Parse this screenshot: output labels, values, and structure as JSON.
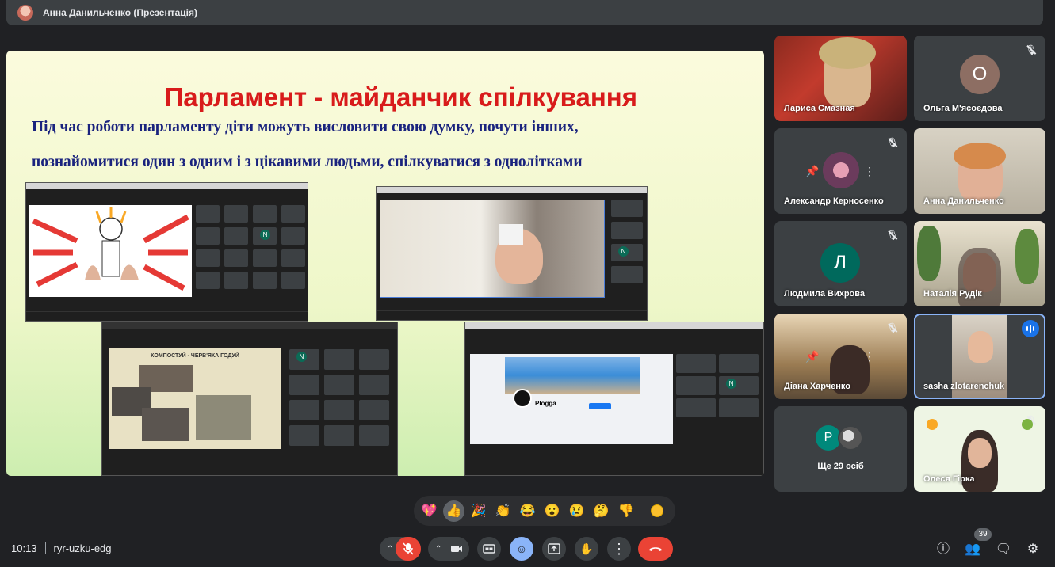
{
  "header": {
    "title": "Анна Данильченко (Презентація)"
  },
  "slide": {
    "title": "Парламент - майданчик спілкування",
    "line1": "Під час роботи парламенту діти можуть висловити свою думку, почути інших,",
    "line2": "познайомитися один з одним і з цікавими людьми, спілкуватися з однолітками",
    "embedded_text": "КОМПОСТУЙ - ЧЕРВ'ЯКА ГОДУЙ",
    "embedded_fb": "Plogga"
  },
  "participants": [
    {
      "name": "Лариса Смазная",
      "muted": false
    },
    {
      "name": "Ольга М'ясоєдова",
      "muted": true,
      "avatar_letter": "О",
      "avatar_color": "#8d6e63"
    },
    {
      "name": "Александр Керносенко",
      "muted": true
    },
    {
      "name": "Анна Данильченко",
      "muted": false
    },
    {
      "name": "Людмила Вихрова",
      "muted": true,
      "avatar_letter": "Л",
      "avatar_color": "#00695c"
    },
    {
      "name": "Наталія Рудік",
      "muted": true
    },
    {
      "name": "Діана Харченко",
      "muted": true
    },
    {
      "name": "sasha zlotarenchuk",
      "muted": false,
      "speaking": true
    },
    {
      "name": "Ще 29 осіб",
      "avatar_letter": "Р",
      "avatar_color": "#00897b"
    },
    {
      "name": "Олеся Гірка",
      "muted": true
    }
  ],
  "reactions": [
    "💖",
    "👍",
    "🎉",
    "👏",
    "😂",
    "😮",
    "😢",
    "🤔",
    "👎"
  ],
  "meeting": {
    "time": "10:13",
    "code": "ryr-uzku-edg",
    "people_count": "39"
  },
  "icons": {
    "mic": "mic-off-icon",
    "camera": "camera-icon",
    "captions": "captions-icon",
    "emoji": "emoji-icon",
    "present": "present-icon",
    "hand": "raise-hand-icon",
    "more": "more-vert-icon",
    "end": "end-call-icon",
    "info": "info-icon",
    "people": "people-icon",
    "chat": "chat-icon",
    "activities": "activities-icon"
  },
  "colors": {
    "end_call": "#ea4335",
    "mic_off": "#ea4335",
    "accent": "#8ab4f8",
    "slide_title": "#d81b1b",
    "slide_text": "#1a237e"
  }
}
